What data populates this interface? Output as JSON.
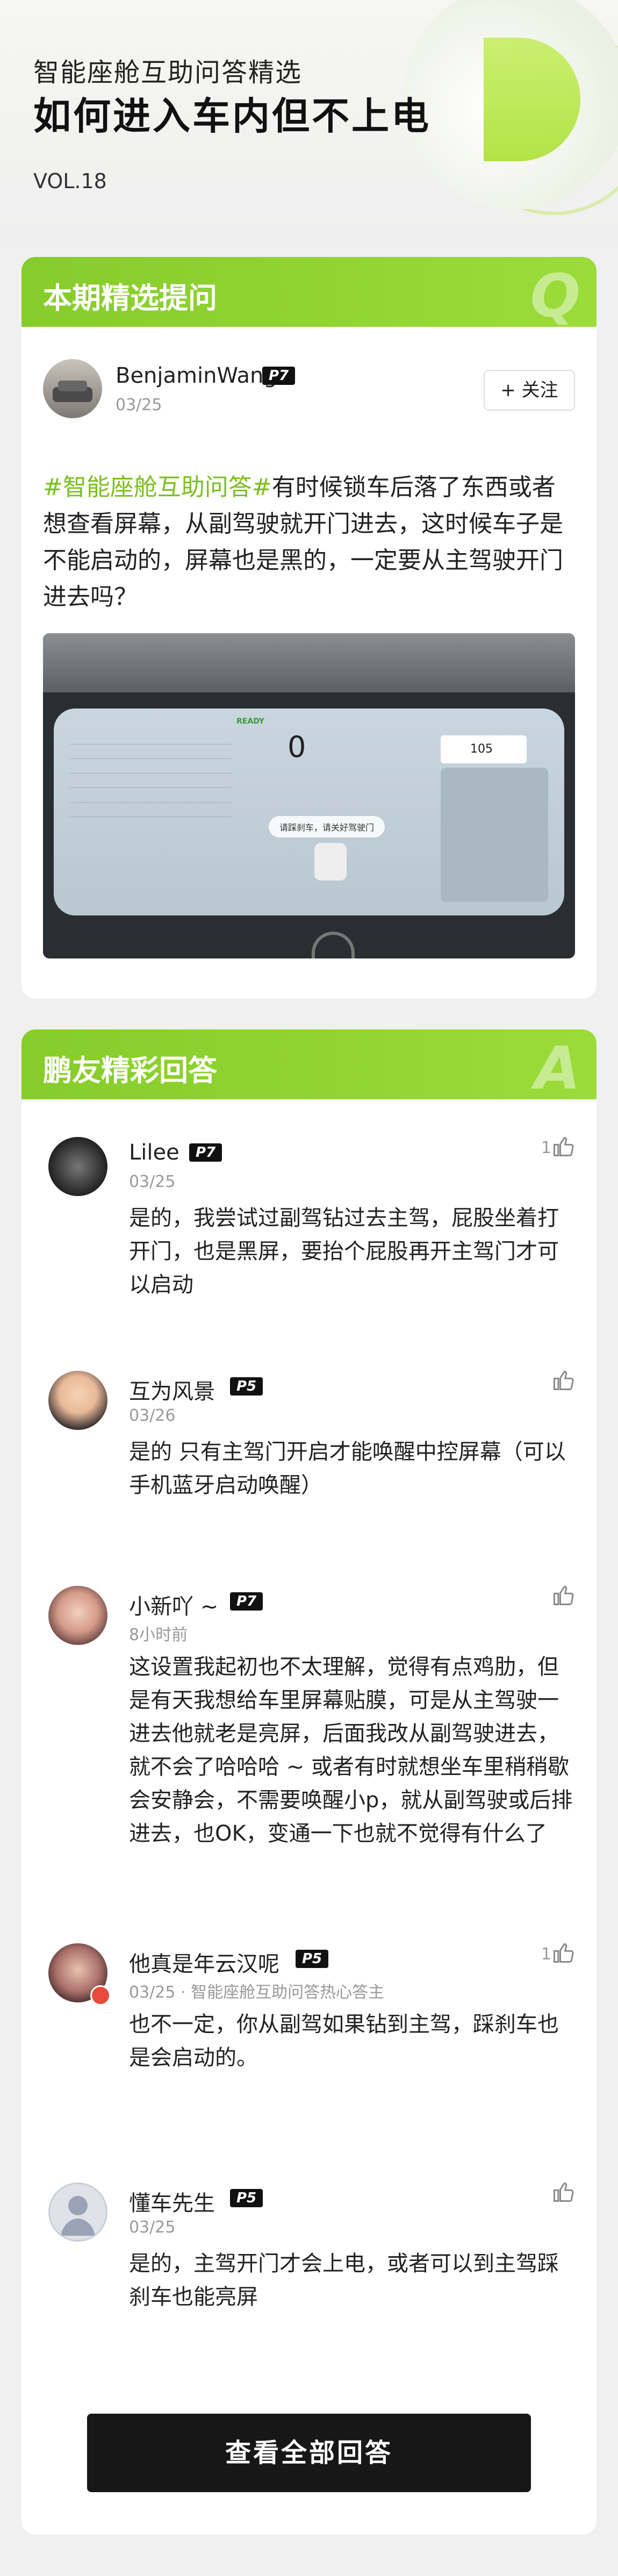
{
  "header": {
    "subtitle": "智能座舱互助问答精选",
    "title": "如何进入车内但不上电",
    "vol": "VOL.18"
  },
  "question_card": {
    "section_label": "本期精选提问",
    "section_letter": "Q",
    "user": {
      "name": "BenjaminWang",
      "level": "P7",
      "date": "03/25"
    },
    "follow_label": "+ 关注",
    "tag": "#智能座舱互助问答#",
    "text": "有时候锁车后落了东西或者想查看屏幕，从副驾驶就开门进去，这时候车子是不能启动的，屏幕也是黑的，一定要从主驾驶开门进去吗？",
    "image": {
      "ready": "READY",
      "speed": "0",
      "nav_distance": "105",
      "message": "请踩刹车，请关好驾驶门"
    }
  },
  "answer_card": {
    "section_label": "鹏友精彩回答",
    "section_letter": "A",
    "answers": [
      {
        "name": "Lilee",
        "level": "P7",
        "date": "03/25",
        "likes": "1",
        "text": "是的，我尝试过副驾钻过去主驾，屁股坐着打开门，也是黑屏，要抬个屁股再开主驾门才可以启动"
      },
      {
        "name": "互为风景",
        "level": "P5",
        "date": "03/26",
        "likes": "",
        "text": "是的 只有主驾门开启才能唤醒中控屏幕（可以手机蓝牙启动唤醒）"
      },
      {
        "name": "小新吖 ~",
        "level": "P7",
        "date": "8小时前",
        "likes": "",
        "text": "这设置我起初也不太理解，觉得有点鸡肋，但是有天我想给车里屏幕贴膜，可是从主驾驶一进去他就老是亮屏，后面我改从副驾驶进去，就不会了哈哈哈 ~ 或者有时就想坐车里稍稍歇会安静会，不需要唤醒小p，就从副驾驶或后排进去，也OK，变通一下也就不觉得有什么了"
      },
      {
        "name": "他真是年云汉呢",
        "level": "P5",
        "date": "03/25 · 智能座舱互助问答热心答主",
        "likes": "1",
        "text": "也不一定，你从副驾如果钻到主驾，踩刹车也是会启动的。"
      },
      {
        "name": "懂车先生",
        "level": "P5",
        "date": "03/25",
        "likes": "",
        "text": "是的，主驾开门才会上电，或者可以到主驾踩刹车也能亮屏"
      }
    ],
    "view_all_label": "查看全部回答"
  },
  "colors": {
    "accent": "#8bd12e",
    "tag": "#7bbf1e",
    "button": "#171717"
  }
}
